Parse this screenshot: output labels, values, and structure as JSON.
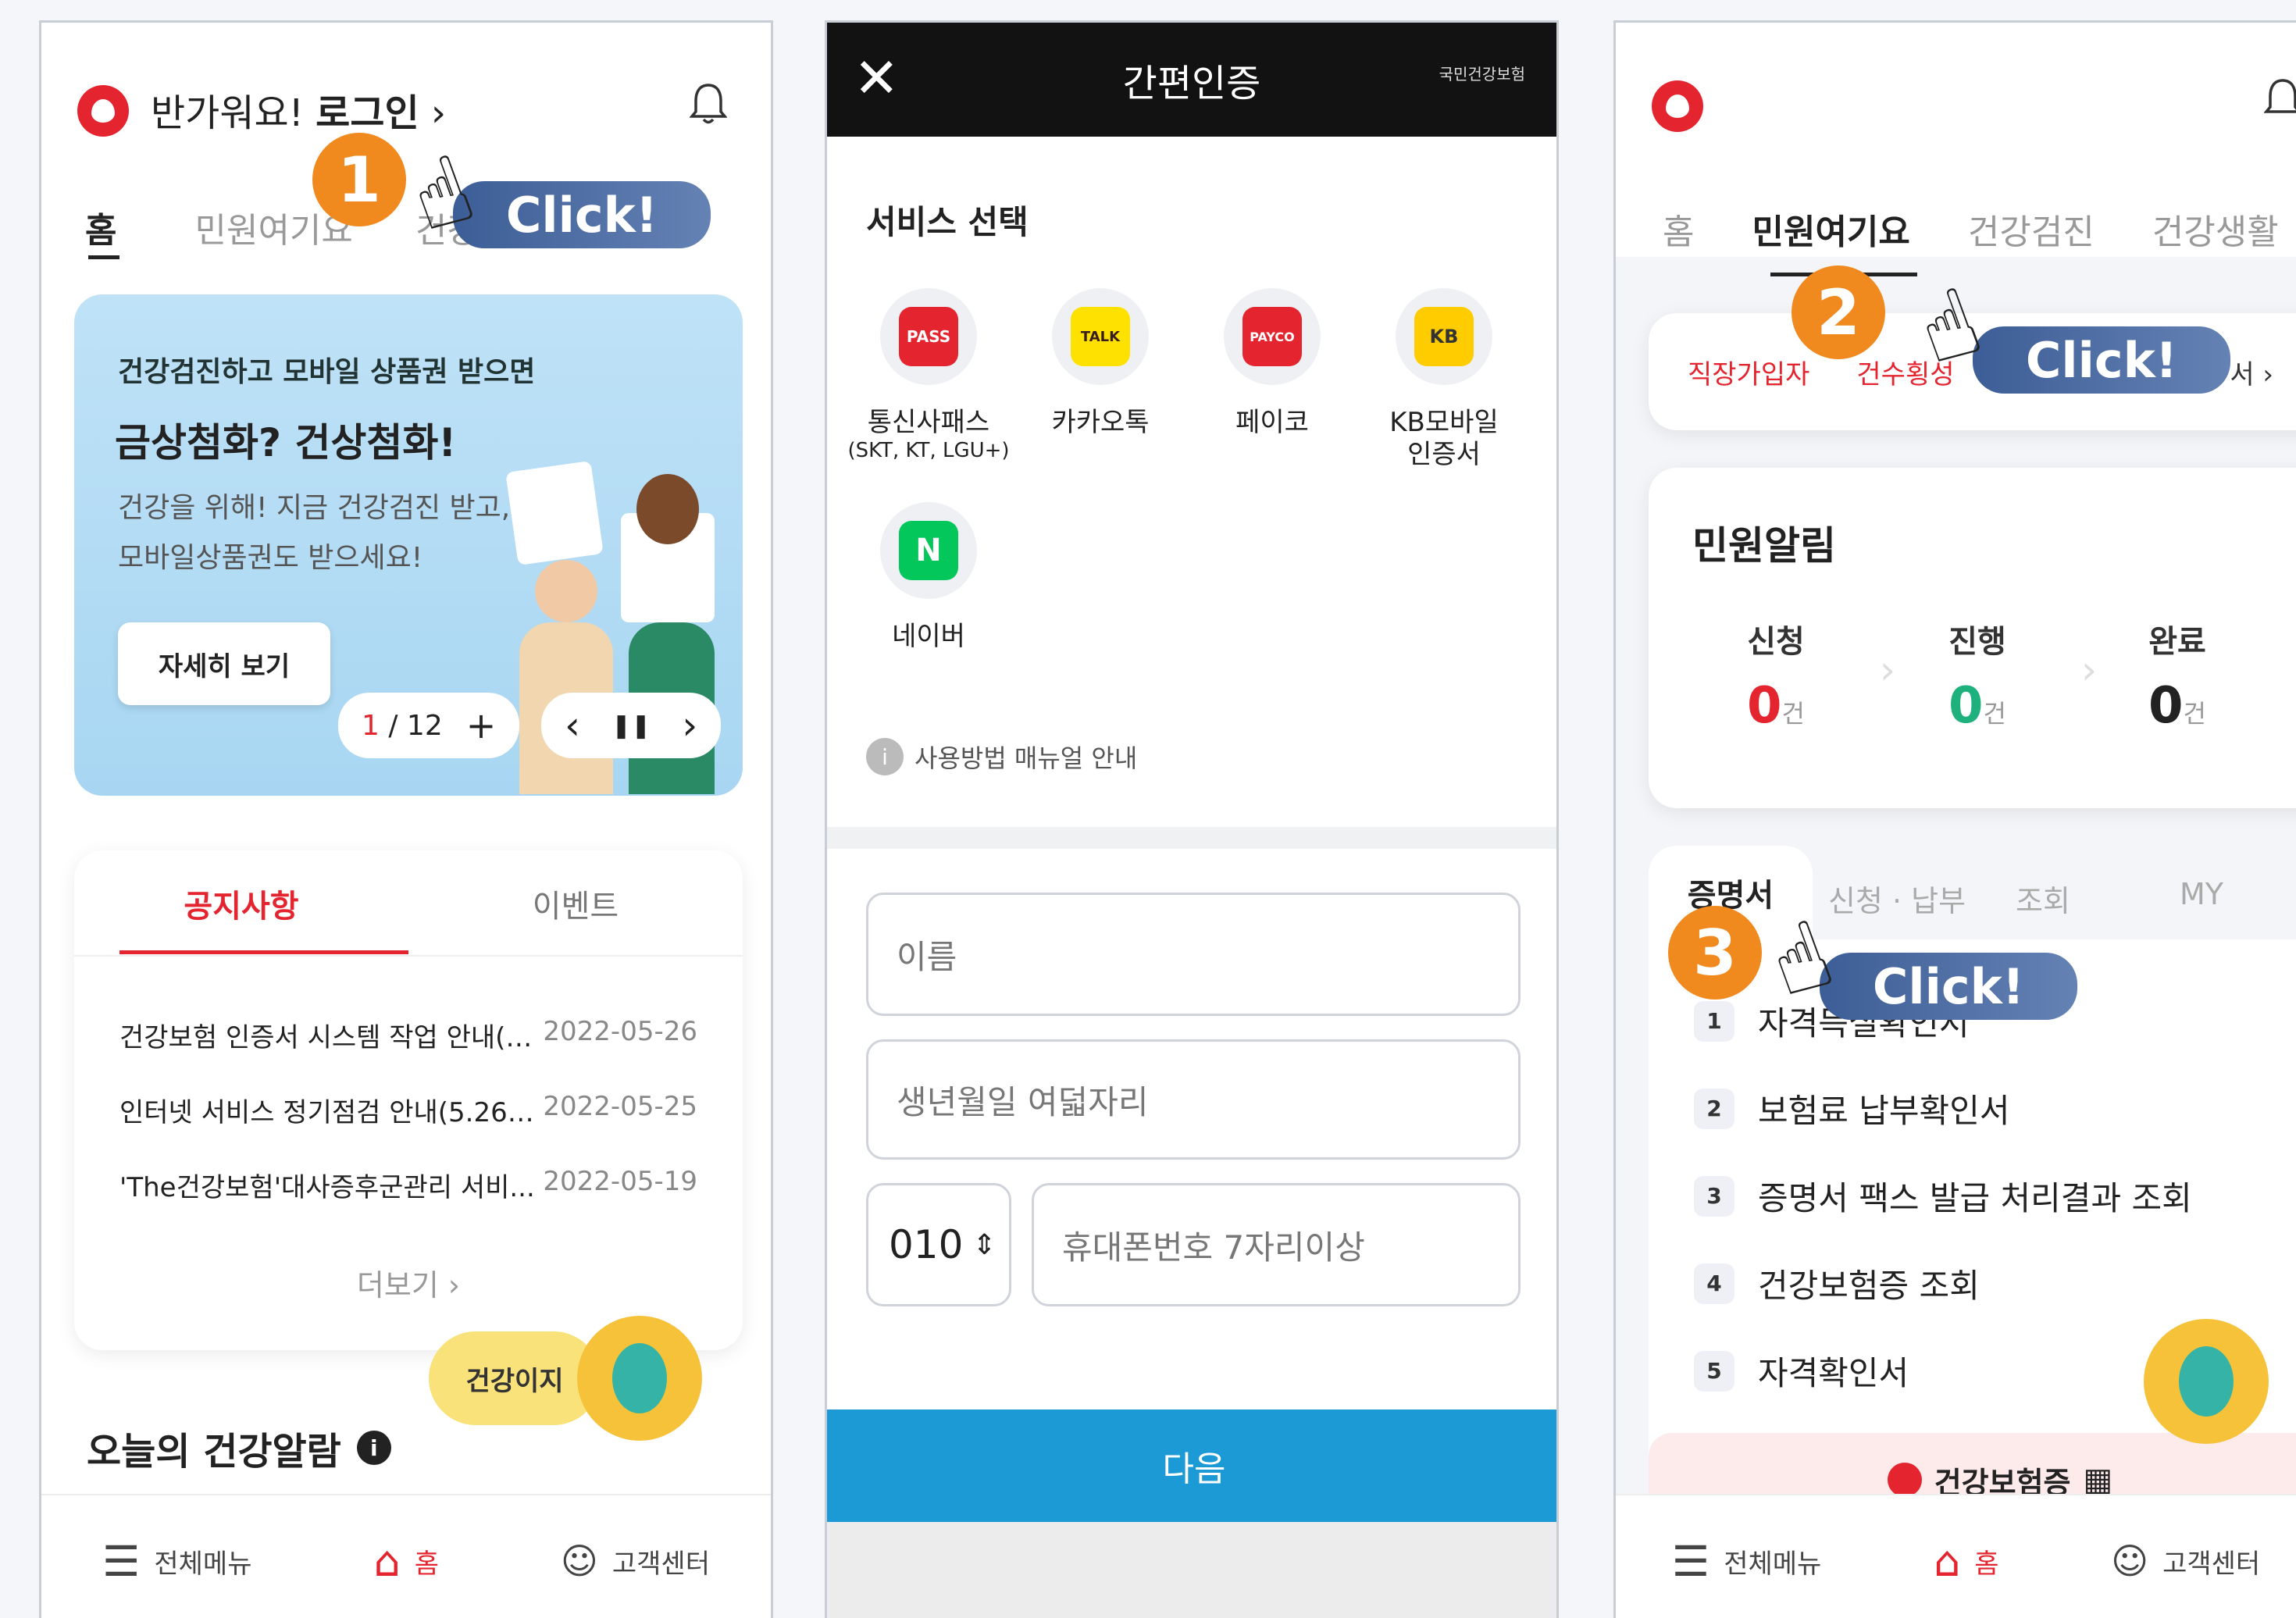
{
  "screen1": {
    "greeting": "반가워요!",
    "login": "로그인",
    "chevron": "›",
    "tabs": [
      "홈",
      "민원여기요",
      "건강검진",
      "건강생활"
    ],
    "banner": {
      "small": "건강검진하고 모바일 상품권 받으면",
      "title": "금상첨화? 건상첨화!",
      "desc1": "건강을 위해! 지금 건강검진 받고,",
      "desc2": "모바일상품권도 받으세요!",
      "button": "자세히 보기",
      "page_current": "1",
      "page_total": "/ 12",
      "plus": "+",
      "prev": "‹",
      "pause": "❚❚",
      "next": "›"
    },
    "notice_tabs": [
      "공지사항",
      "이벤트"
    ],
    "notices": [
      {
        "title": "건강보험 인증서 시스템 작업 안내(5....",
        "date": "2022-05-26"
      },
      {
        "title": "인터넷 서비스 정기점검 안내(5.26. ...",
        "date": "2022-05-25"
      },
      {
        "title": "'The건강보험'대사증후군관리 서비...",
        "date": "2022-05-19"
      }
    ],
    "more": "더보기 ›",
    "health_alarm": "오늘의 건강알람",
    "chatbot_pill": "건강이지",
    "nav": [
      "전체메뉴",
      "홈",
      "고객센터"
    ]
  },
  "screen2": {
    "title": "간편인증",
    "brand": "국민건강보험",
    "section": "서비스 선택",
    "services": [
      {
        "label": "통신사패스",
        "sub": "(SKT, KT, LGU+)",
        "icon": "PASS",
        "color": "#e4242f"
      },
      {
        "label": "카카오톡",
        "sub": "",
        "icon": "TALK",
        "color": "#ffe100"
      },
      {
        "label": "페이코",
        "sub": "",
        "icon": "PAYCO",
        "color": "#e4242f"
      },
      {
        "label": "KB모바일",
        "sub": "인증서",
        "icon": "KB",
        "color": "#ffcc00"
      },
      {
        "label": "네이버",
        "sub": "",
        "icon": "N",
        "color": "#03c75a"
      }
    ],
    "manual": "사용방법 매뉴얼 안내",
    "name_placeholder": "이름",
    "birth_placeholder": "생년월일 여덟자리",
    "phone_prefix": "010",
    "phone_placeholder": "휴대폰번호 7자리이상",
    "next": "다음"
  },
  "screen3": {
    "tabs": [
      "홈",
      "민원여기요",
      "건강검진",
      "건강생활"
    ],
    "quick": [
      "직장가입자",
      "건수횡성"
    ],
    "quick_more": "서 ›",
    "alert_title": "민원알림",
    "status": [
      {
        "label": "신청",
        "count": "0",
        "unit": "건",
        "color": "#e4242f"
      },
      {
        "label": "진행",
        "count": "0",
        "unit": "건",
        "color": "#1fb17d"
      },
      {
        "label": "완료",
        "count": "0",
        "unit": "건",
        "color": "#222222"
      }
    ],
    "sub_tabs": [
      "증명서",
      "신청 · 납부",
      "조회",
      "MY"
    ],
    "certs": [
      {
        "num": "1",
        "label": "자격득실확인서"
      },
      {
        "num": "2",
        "label": "보험료 납부확인서"
      },
      {
        "num": "3",
        "label": "증명서 팩스 발급 처리결과 조회"
      },
      {
        "num": "4",
        "label": "건강보험증 조회"
      },
      {
        "num": "5",
        "label": "자격확인서"
      }
    ],
    "card_label": "건강보험증",
    "nav": [
      "전체메뉴",
      "홈",
      "고객센터"
    ]
  },
  "annotations": {
    "step1": "1",
    "step2": "2",
    "step3": "3",
    "click": "Click!"
  },
  "colors": {
    "brand_red": "#e4242f",
    "step_orange": "#f08a1f",
    "click_blue": "#4a6aa5",
    "next_blue": "#1c9ad6"
  }
}
